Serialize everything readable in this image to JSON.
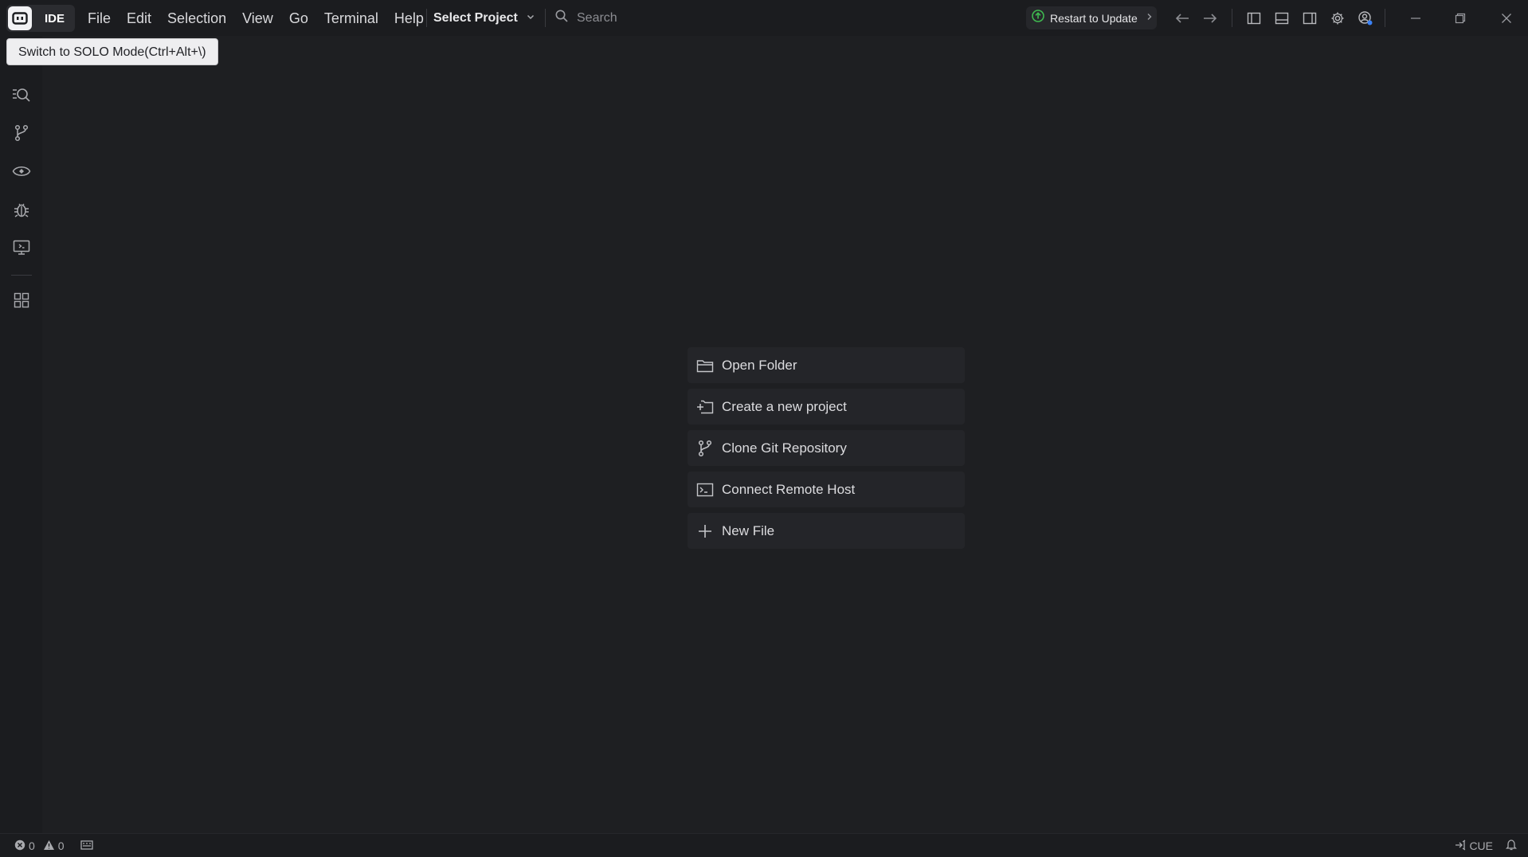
{
  "titlebar": {
    "mode_label": "IDE",
    "menu": [
      "File",
      "Edit",
      "Selection",
      "View",
      "Go",
      "Terminal",
      "Help"
    ],
    "project_select": "Select Project",
    "search_placeholder": "Search",
    "update_button": "Restart to Update"
  },
  "tooltip": "Switch to SOLO Mode(Ctrl+Alt+\\)",
  "activity_bar": [
    "search-icon",
    "source-control-icon",
    "remote-icon",
    "debug-icon",
    "remote-explorer-icon",
    "extensions-icon"
  ],
  "welcome_actions": [
    {
      "label": "Open Folder",
      "icon": "folder-icon"
    },
    {
      "label": "Create a new project",
      "icon": "new-project-icon"
    },
    {
      "label": "Clone Git Repository",
      "icon": "git-branch-icon"
    },
    {
      "label": "Connect Remote Host",
      "icon": "remote-host-icon"
    },
    {
      "label": "New File",
      "icon": "plus-icon"
    }
  ],
  "statusbar": {
    "errors": "0",
    "warnings": "0",
    "language": "CUE"
  },
  "colors": {
    "background": "#1e1f22",
    "titlebar": "#1b1c1f",
    "update_dot": "#3fb950",
    "accent": "#3b82f6"
  }
}
